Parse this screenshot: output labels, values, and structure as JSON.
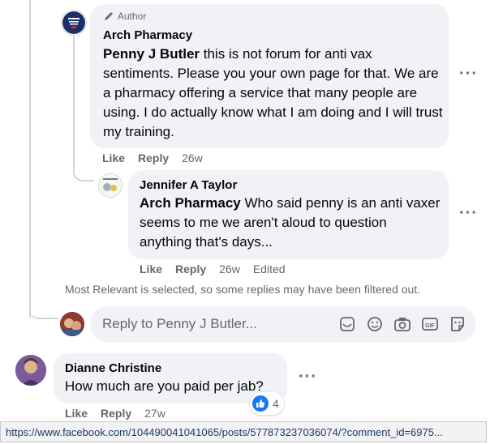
{
  "comments": [
    {
      "author_badge": "Author",
      "name": "Arch Pharmacy",
      "mention": "Penny J Butler",
      "text": " this is not forum for anti vax sentiments. Please you your own page for that. We are a pharmacy offering a service that many people are using. I do actually know what I am doing and I will trust my training.",
      "like_label": "Like",
      "reply_label": "Reply",
      "time": "26w"
    },
    {
      "name": "Jennifer A Taylor",
      "mention": "Arch Pharmacy",
      "text": " Who said penny is an anti vaxer seems to me we aren't aloud to question anything that's days...",
      "like_label": "Like",
      "reply_label": "Reply",
      "time": "26w",
      "edited_label": "Edited"
    },
    {
      "name": "Dianne Christine",
      "text": "How much are you paid per jab?",
      "like_label": "Like",
      "reply_label": "Reply",
      "time": "27w",
      "reaction_count": "4"
    }
  ],
  "filter_note": "Most Relevant is selected, so some replies may have been filtered out.",
  "reply_box": {
    "placeholder": "Reply to Penny J Butler..."
  },
  "reply_tools": [
    "sticker-icon",
    "emoji-icon",
    "camera-icon",
    "gif-icon",
    "sticker-face-icon"
  ],
  "status_url": "https://www.facebook.com/104490041041065/posts/577873237036074/?comment_id=6975...",
  "colors": {
    "bubble": "#f0f2f5",
    "secondary_text": "#65676b",
    "like_blue": "#1877f2"
  }
}
